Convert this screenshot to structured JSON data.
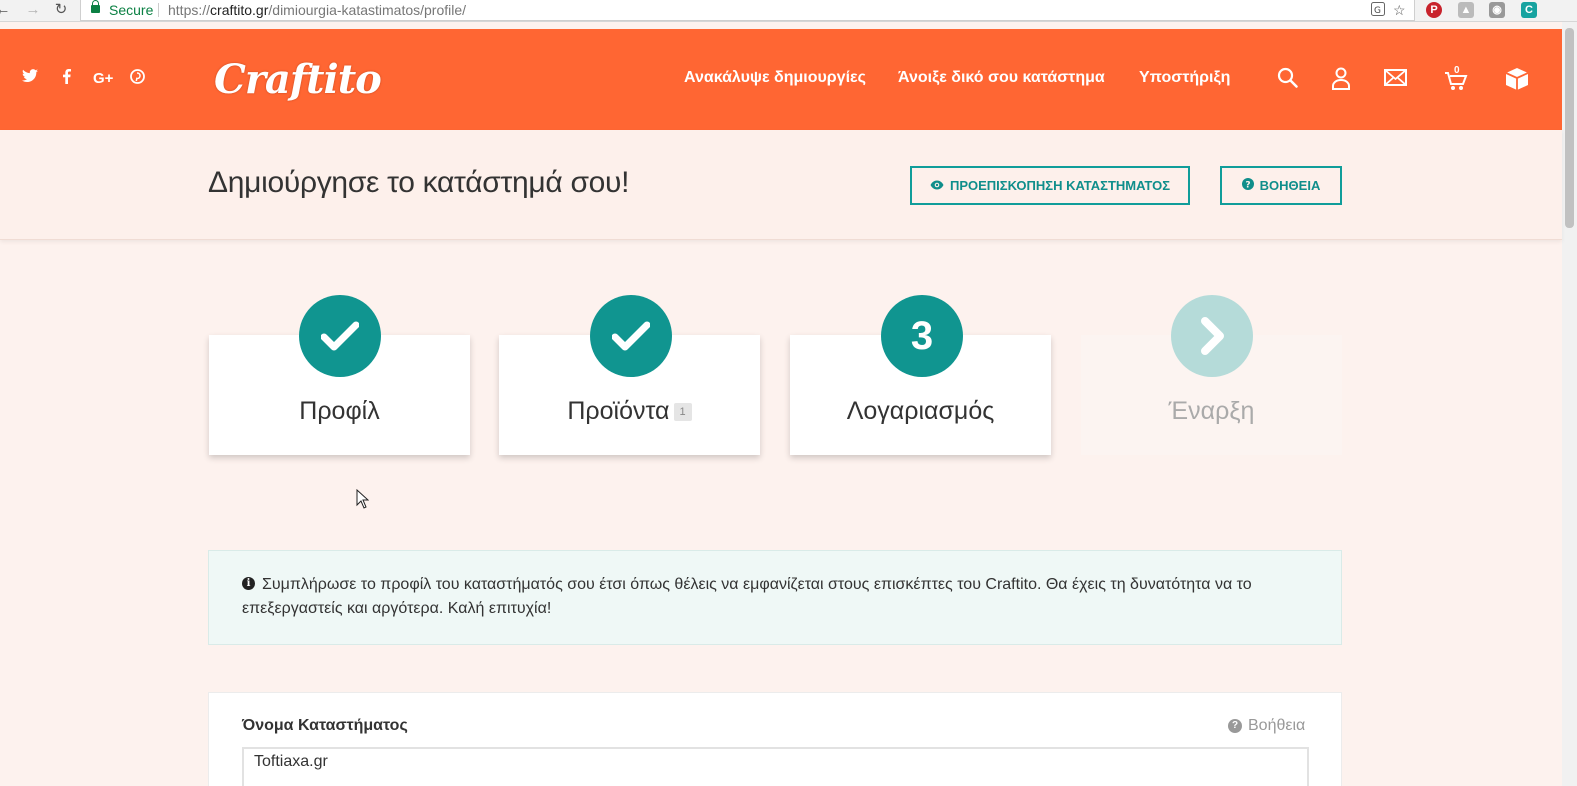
{
  "browser": {
    "secure_label": "Secure",
    "url_scheme": "https://",
    "url_host": "craftito.gr",
    "url_path": "/dimiourgia-katastimatos/profile/",
    "extension_c_label": "C"
  },
  "header": {
    "logo": "Craftito",
    "nav": [
      {
        "label": "Ανακάλυψε δημιουργίες"
      },
      {
        "label": "Άνοιξε δικό σου κατάστημα"
      },
      {
        "label": "Υποστήριξη"
      }
    ],
    "cart_count": "0",
    "social_icons": [
      "twitter-icon",
      "facebook-icon",
      "google-plus-icon",
      "pinterest-icon"
    ],
    "accent_color": "#ff6633"
  },
  "titlebar": {
    "title": "Δημιούργησε το κατάστημά σου!",
    "preview_button": "ΠΡΟΕΠΙΣΚΟΠΗΣΗ ΚΑΤΑΣΤΗΜΑΤΟΣ",
    "help_button": "ΒΟΗΘΕΙΑ"
  },
  "steps": [
    {
      "label": "Προφίλ",
      "state": "done",
      "icon": "check-icon"
    },
    {
      "label": "Προϊόντα",
      "state": "done",
      "icon": "check-icon",
      "badge": "1"
    },
    {
      "label": "Λογαριασμός",
      "state": "current",
      "number": "3"
    },
    {
      "label": "Έναρξη",
      "state": "disabled",
      "icon": "chevron-right-icon"
    }
  ],
  "info": {
    "text": "Συμπλήρωσε το προφίλ του καταστήματός σου έτσι όπως θέλεις να εμφανίζεται στους επισκέπτες του Craftito. Θα έχεις τη δυνατότητα να το επεξεργαστείς και αργότερα. Καλή επιτυχία!"
  },
  "form": {
    "shop_name_label": "Όνομα Καταστήματος",
    "help_label": "Βοήθεια",
    "shop_name_value": "Toftiaxa.gr"
  },
  "colors": {
    "teal": "#109590",
    "teal_light": "#b5dbd9",
    "page_bg": "#fdf2ee"
  }
}
